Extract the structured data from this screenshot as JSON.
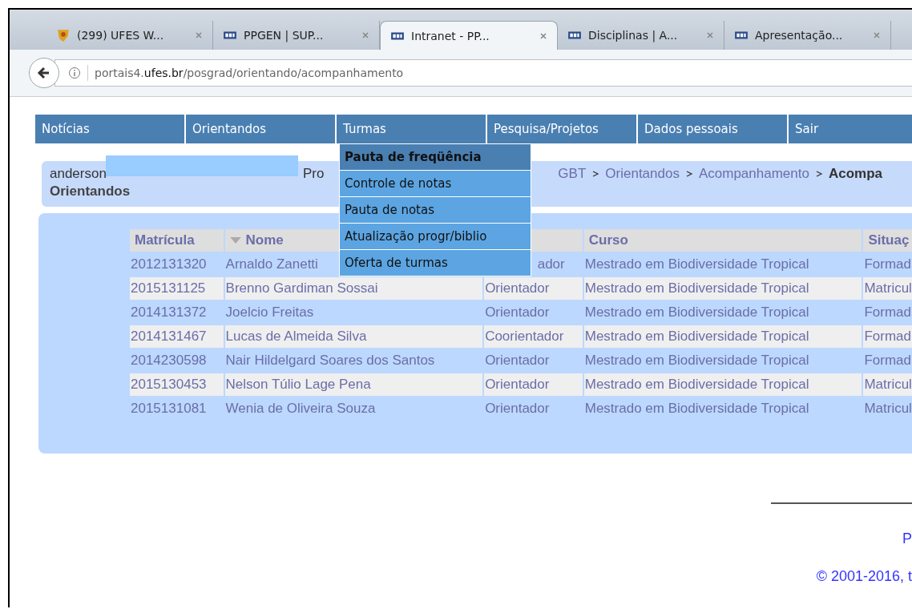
{
  "browser": {
    "tabs": [
      {
        "title": "(299) UFES W...",
        "kind": "crest",
        "selected": false
      },
      {
        "title": "PPGEN | SUP...",
        "kind": "logo",
        "selected": false
      },
      {
        "title": "Intranet - PP...",
        "kind": "logo",
        "selected": true
      },
      {
        "title": "Disciplinas | A...",
        "kind": "logo",
        "selected": false
      },
      {
        "title": "Apresentação...",
        "kind": "logo",
        "selected": false
      }
    ],
    "url": {
      "prefix": "portais4.",
      "domain": "ufes.br",
      "path": "/posgrad/orientando/acompanhamento"
    }
  },
  "nav": {
    "items": [
      "Notícias",
      "Orientandos",
      "Turmas",
      "Pesquisa/Projetos",
      "Dados pessoais",
      "Sair"
    ],
    "dropdown": [
      {
        "label": "Pauta de freqüência",
        "selected": true
      },
      {
        "label": "Controle de notas",
        "selected": false
      },
      {
        "label": "Pauta de notas",
        "selected": false
      },
      {
        "label": "Atualização progr/biblio",
        "selected": false
      },
      {
        "label": "Oferta de turmas",
        "selected": false
      }
    ]
  },
  "breadcrumb": {
    "user": "anderson",
    "program_prefix": "Pro",
    "trail": [
      "GBT",
      "Orientandos",
      "Acompanhamento"
    ],
    "current": "Acompa",
    "page_title": "Orientandos"
  },
  "table": {
    "columns": [
      "Matrícula",
      "Nome",
      "",
      "Curso",
      "Situaç"
    ],
    "rows": [
      [
        "2012131320",
        "Arnaldo Zanetti",
        "ador",
        "Mestrado em Biodiversidade Tropical",
        "Formad"
      ],
      [
        "2015131125",
        "Brenno Gardiman Sossai",
        "Orientador",
        "Mestrado em Biodiversidade Tropical",
        "Matricul"
      ],
      [
        "2014131372",
        "Joelcio Freitas",
        "Orientador",
        "Mestrado em Biodiversidade Tropical",
        "Formad"
      ],
      [
        "2014131467",
        "Lucas de Almeida Silva",
        "Coorientador",
        "Mestrado em Biodiversidade Tropical",
        "Formad"
      ],
      [
        "2014230598",
        "Nair Hildelgard Soares dos Santos",
        "Orientador",
        "Mestrado em Biodiversidade Tropical",
        "Formad"
      ],
      [
        "2015130453",
        "Nelson Túlio Lage Pena",
        "Orientador",
        "Mestrado em Biodiversidade Tropical",
        "Matricul"
      ],
      [
        "2015131081",
        "Wenia de Oliveira Souza",
        "Orientador",
        "Mestrado em Biodiversidade Tropical",
        "Matricul"
      ]
    ]
  },
  "footer": {
    "link": "P",
    "copyright": "© 2001-2016, t"
  }
}
